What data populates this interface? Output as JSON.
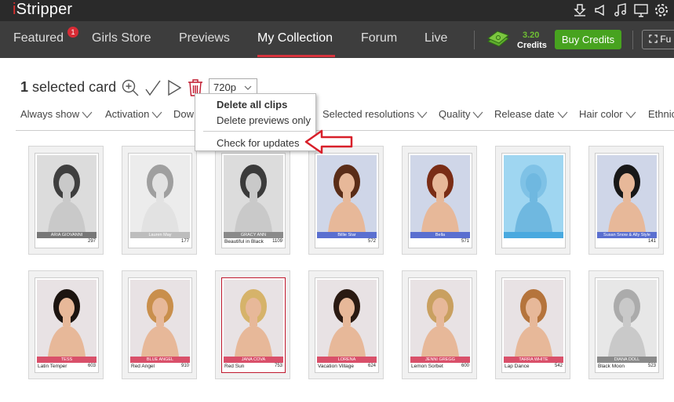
{
  "app": {
    "logo_i": "i",
    "logo_rest": "Stripper"
  },
  "titlebar_icons": [
    "download-icon",
    "announce-icon",
    "music-icon",
    "monitor-icon",
    "settings-icon"
  ],
  "nav": {
    "items": [
      "Featured",
      "Girls Store",
      "Previews",
      "My Collection",
      "Forum",
      "Live"
    ],
    "active": "My Collection",
    "featured_badge": "1",
    "credits_amount": "3.20",
    "credits_label": "Credits",
    "buy_credits": "Buy Credits",
    "fullscreen": "Fu"
  },
  "toolbar": {
    "selected_count": "1",
    "selected_label": "selected card",
    "resolution": "720p"
  },
  "filters": [
    "Always show",
    "Activation",
    "Dow",
    "Selected resolutions",
    "Quality",
    "Release date",
    "Hair color",
    "Ethnic"
  ],
  "menu": {
    "items": [
      "Delete all clips",
      "Delete previews only",
      "Check for updates"
    ]
  },
  "cards": [
    {
      "band": "ARIA GIOVANNI",
      "title": "",
      "num": "297",
      "style": "gray",
      "hair": "#2b1b14",
      "band_color": "#777777"
    },
    {
      "band": "Lauren May",
      "title": "",
      "num": "177",
      "style": "faded",
      "hair": "#3a2a20",
      "band_color": "#bdbdbd"
    },
    {
      "band": "GRACY ANN",
      "title": "Beautiful in Black",
      "num": "1109",
      "style": "gray",
      "hair": "#1a1a1a",
      "band_color": "#8a8a8a"
    },
    {
      "band": "Billie Star",
      "title": "",
      "num": "572",
      "style": "color",
      "hair": "#5a2d18",
      "band_color": "#5a6fd0"
    },
    {
      "band": "Bella",
      "title": "",
      "num": "571",
      "style": "color",
      "hair": "#7a2d16",
      "band_color": "#5a6fd0"
    },
    {
      "band": "",
      "title": "",
      "num": "",
      "style": "empty",
      "hair": "#7fc2e6",
      "band_color": "#49a9df"
    },
    {
      "band": "Susan Snow & Ally Style",
      "title": "",
      "num": "141",
      "style": "color",
      "hair": "#181818",
      "band_color": "#5a6fd0"
    },
    {
      "band": "TESS",
      "title": "Latin Temper",
      "num": "603",
      "style": "color",
      "hair": "#1c1410",
      "band_color": "#d9506a"
    },
    {
      "band": "BLUE ANGEL",
      "title": "Red Angel",
      "num": "910",
      "style": "color",
      "hair": "#c98f4c",
      "band_color": "#d9506a"
    },
    {
      "band": "JANA COVA",
      "title": "Red Sun",
      "num": "753",
      "style": "selected",
      "hair": "#d6b36a",
      "band_color": "#d9506a"
    },
    {
      "band": "LORENA",
      "title": "Vacation Village",
      "num": "624",
      "style": "color",
      "hair": "#2a1a12",
      "band_color": "#d9506a"
    },
    {
      "band": "JENNI GREGG",
      "title": "Lemon Sorbet",
      "num": "600",
      "style": "color",
      "hair": "#c9a060",
      "band_color": "#d9506a"
    },
    {
      "band": "TARRA WHITE",
      "title": "Lap Dance",
      "num": "542",
      "style": "color",
      "hair": "#b5743c",
      "band_color": "#d9506a"
    },
    {
      "band": "DIANA DOLL",
      "title": "Black Moon",
      "num": "523",
      "style": "gray",
      "hair": "#b89a66",
      "band_color": "#8a8a8a"
    }
  ],
  "colors": {
    "titlebar": "#2a2a2a",
    "navbar": "#3d3d3d",
    "accent_red": "#d8333d",
    "buy_green": "#47a31f",
    "credits_green": "#6fc033"
  }
}
